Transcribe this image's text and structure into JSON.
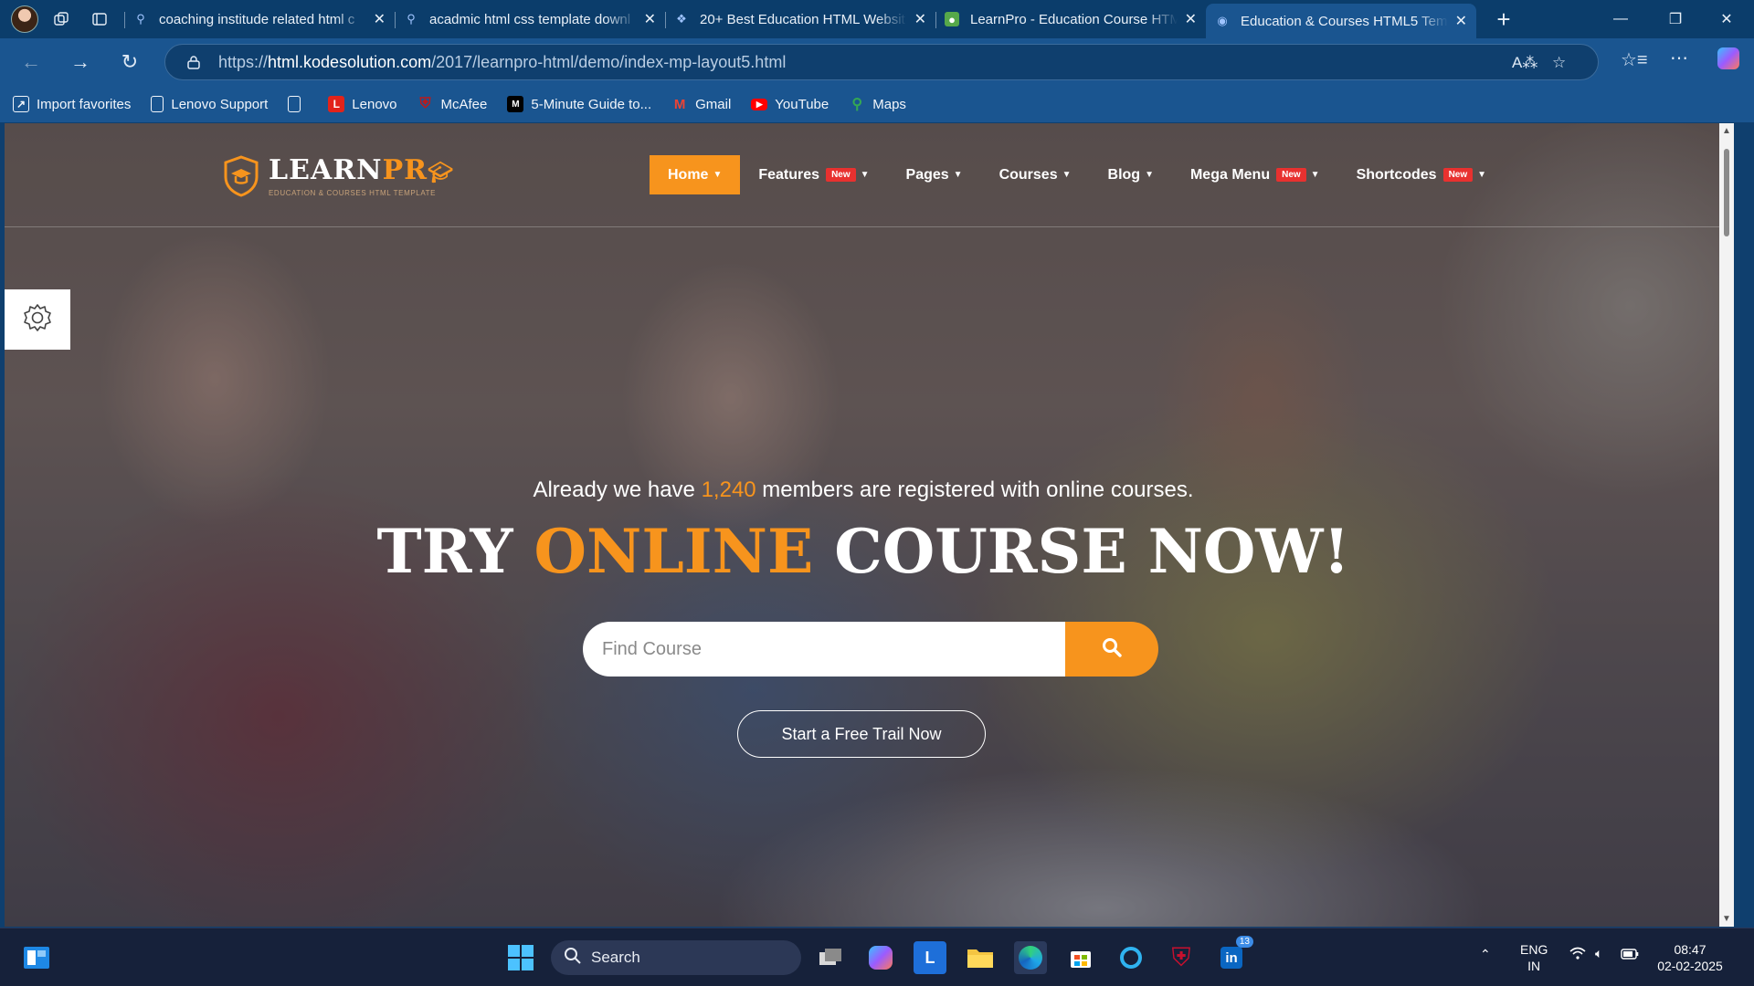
{
  "browser": {
    "tabs": [
      {
        "title": "coaching institude related html c",
        "favicon": "search-icon"
      },
      {
        "title": "acadmic html css template downl",
        "favicon": "search-icon"
      },
      {
        "title": "20+ Best Education HTML Websit",
        "favicon": "site-icon"
      },
      {
        "title": "LearnPro - Education Course HTM",
        "favicon": "envato-icon"
      },
      {
        "title": "Education & Courses HTML5 Tem",
        "favicon": "site-icon",
        "active": true
      }
    ],
    "address": {
      "prefix": "https://",
      "domain": "html.kodesolution.com",
      "path": "/2017/learnpro-html/demo/index-mp-layout5.html"
    },
    "favorites": [
      {
        "label": "Import favorites",
        "icon": "import-icon"
      },
      {
        "label": "Lenovo Support",
        "icon": "page-icon"
      },
      {
        "label": "",
        "icon": "page-icon"
      },
      {
        "label": "Lenovo",
        "icon": "lenovo-icon"
      },
      {
        "label": "McAfee",
        "icon": "mcafee-icon"
      },
      {
        "label": "5-Minute Guide to...",
        "icon": "medium-icon"
      },
      {
        "label": "Gmail",
        "icon": "gmail-icon"
      },
      {
        "label": "YouTube",
        "icon": "youtube-icon"
      },
      {
        "label": "Maps",
        "icon": "maps-icon"
      }
    ]
  },
  "site": {
    "logo": {
      "name_main": "LEARN",
      "name_accent": "PR",
      "tagline": "EDUCATION & COURSES HTML TEMPLATE"
    },
    "menu": [
      {
        "label": "Home",
        "badge": "",
        "active": true
      },
      {
        "label": "Features",
        "badge": "New"
      },
      {
        "label": "Pages",
        "badge": ""
      },
      {
        "label": "Courses",
        "badge": ""
      },
      {
        "label": "Blog",
        "badge": ""
      },
      {
        "label": "Mega Menu",
        "badge": "New"
      },
      {
        "label": "Shortcodes",
        "badge": "New"
      }
    ],
    "hero": {
      "sub_before": "Already we have ",
      "sub_number": "1,240",
      "sub_after": " members are registered with online courses.",
      "title_start": "TRY ",
      "title_accent": "ONLINE",
      "title_end": " COURSE NOW!",
      "search_placeholder": "Find Course",
      "cta": "Start a Free Trail Now"
    }
  },
  "taskbar": {
    "search_label": "Search",
    "lang_top": "ENG",
    "lang_bottom": "IN",
    "time": "08:47",
    "date": "02-02-2025",
    "badge_count": "13"
  },
  "colors": {
    "accent": "#f7941d",
    "badge": "#e8312f",
    "browser_bg": "#1a5590",
    "taskbar_bg": "#16213a"
  }
}
